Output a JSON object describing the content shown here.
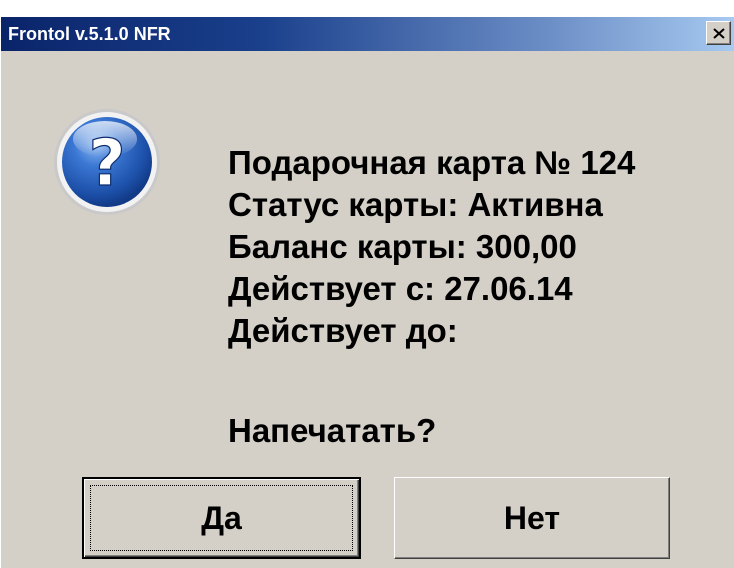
{
  "window": {
    "title": "Frontol v.5.1.0 NFR",
    "close_icon": "close-icon"
  },
  "dialog": {
    "icon": "question-icon",
    "lines": [
      "Подарочная карта № 124",
      "Статус карты: Активна",
      "Баланс карты: 300,00",
      "Действует с: 27.06.14",
      "Действует до:"
    ],
    "prompt": "Напечатать?"
  },
  "buttons": {
    "yes_label": "Да",
    "no_label": "Нет"
  },
  "colors": {
    "dialog_bg": "#d4d0c8",
    "titlebar_start": "#0a246a",
    "titlebar_end": "#a6caf0",
    "icon_blue": "#1f5bb5"
  }
}
